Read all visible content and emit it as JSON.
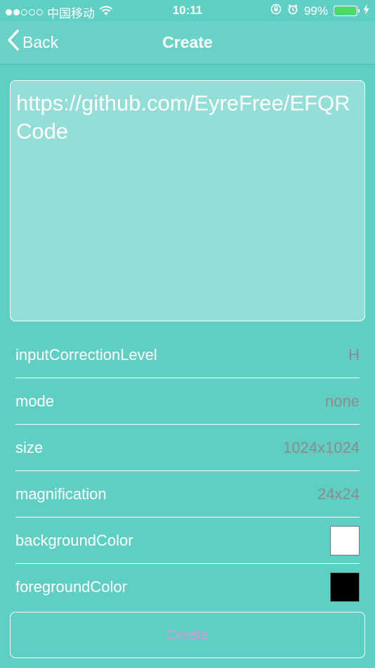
{
  "status_bar": {
    "carrier": "中国移动",
    "time": "10:11",
    "battery_percent": "99%",
    "battery_level": 0.99
  },
  "nav": {
    "back_label": "Back",
    "title": "Create"
  },
  "content_input": {
    "value": "https://github.com/EyreFree/EFQRCode"
  },
  "settings": {
    "rows": [
      {
        "label": "inputCorrectionLevel",
        "value": "H"
      },
      {
        "label": "mode",
        "value": "none"
      },
      {
        "label": "size",
        "value": "1024x1024"
      },
      {
        "label": "magnification",
        "value": "24x24"
      },
      {
        "label": "backgroundColor",
        "color": "#ffffff"
      },
      {
        "label": "foregroundColor",
        "color": "#000000"
      }
    ]
  },
  "create_button": {
    "label": "Create"
  },
  "colors": {
    "background": "#5fcfc4",
    "nav_background": "#6ad1c6",
    "input_background": "#93dfd7",
    "value_text": "#8b8b8b",
    "button_text": "#d29bd8",
    "battery_fill": "#4cd964"
  },
  "icons": {
    "signal": "signal-dots-icon",
    "wifi": "wifi-icon",
    "orientation_lock": "orientation-lock-icon",
    "alarm": "alarm-icon",
    "battery": "battery-icon",
    "charging": "charging-bolt-icon",
    "back": "chevron-left-icon"
  }
}
